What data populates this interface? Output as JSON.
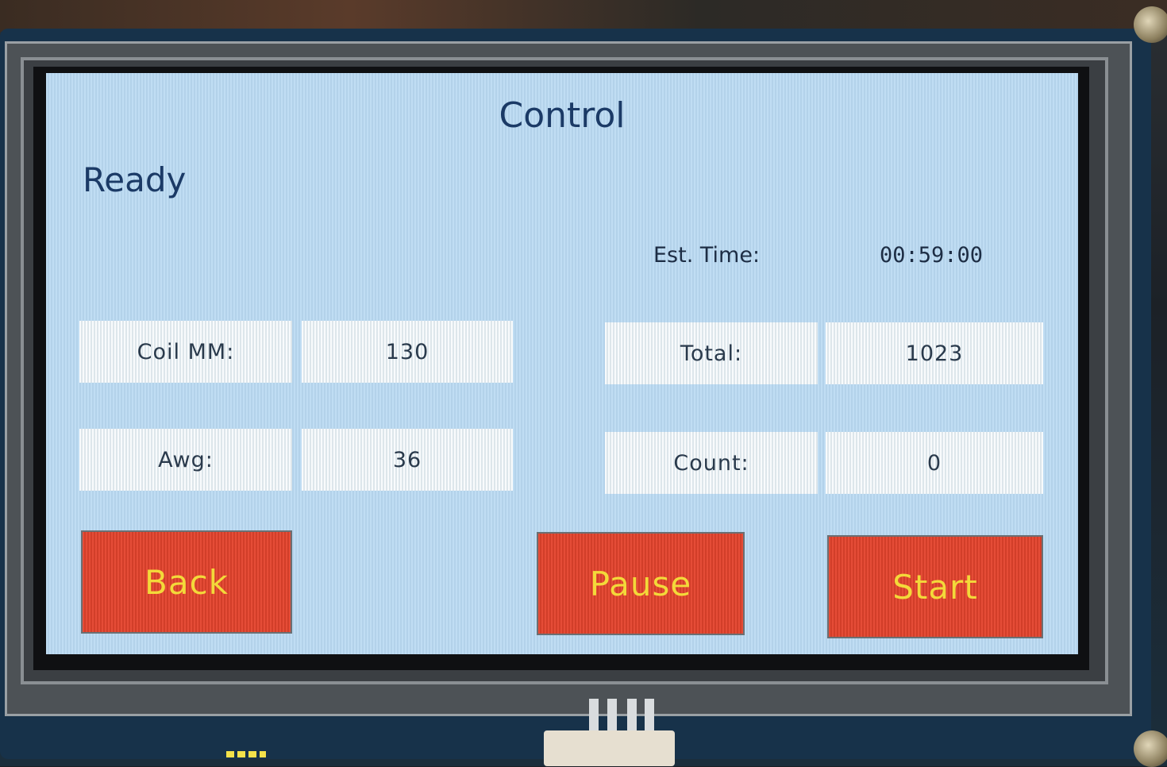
{
  "screen": {
    "title": "Control",
    "status": "Ready",
    "est_time": {
      "label": "Est. Time:",
      "value": "00:59:00"
    },
    "fields": {
      "coil_mm": {
        "label": "Coil MM:",
        "value": "130"
      },
      "awg": {
        "label": "Awg:",
        "value": "36"
      },
      "total": {
        "label": "Total:",
        "value": "1023"
      },
      "count": {
        "label": "Count:",
        "value": "0"
      }
    },
    "buttons": {
      "back": "Back",
      "pause": "Pause",
      "start": "Start"
    }
  },
  "colors": {
    "screen_background": "#b9d9f2",
    "text_primary": "#1b3a66",
    "button_fill": "#e4432c",
    "button_text": "#f3d93a",
    "cell_fill": "#eef4f7"
  }
}
